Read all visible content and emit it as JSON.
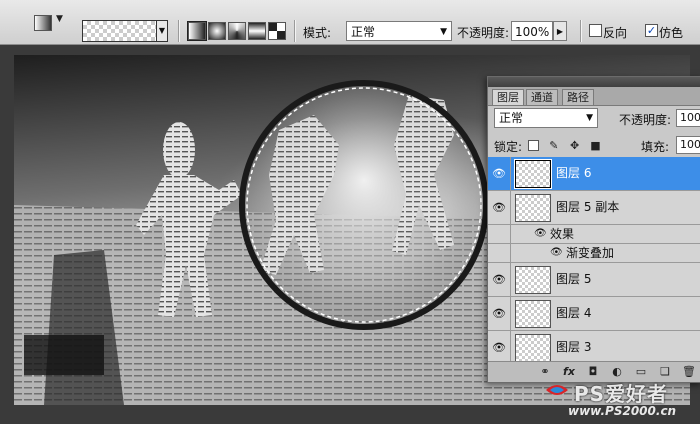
{
  "options_bar": {
    "mode_label": "模式:",
    "mode_value": "正常",
    "opacity_label": "不透明度:",
    "opacity_value": "100%",
    "reverse_label": "反向",
    "reverse_checked": false,
    "dither_label": "仿色",
    "dither_checked": true
  },
  "layers_panel": {
    "tabs": [
      {
        "label": "图层",
        "active": true
      },
      {
        "label": "通道",
        "active": false
      },
      {
        "label": "路径",
        "active": false
      }
    ],
    "blend_mode": "正常",
    "opacity_label": "不透明度:",
    "opacity_value": "100",
    "lock_label": "锁定:",
    "fill_label": "填充:",
    "fill_value": "100",
    "layers": [
      {
        "name": "图层 6",
        "selected": true
      },
      {
        "name": "图层 5 副本",
        "selected": false
      },
      {
        "name": "效果",
        "kind": "effects"
      },
      {
        "name": "渐变叠加",
        "kind": "effect"
      },
      {
        "name": "图层 5",
        "selected": false
      },
      {
        "name": "图层 4",
        "selected": false
      },
      {
        "name": "图层 3",
        "selected": false
      }
    ]
  },
  "watermark": {
    "brand": "PS爱好者",
    "url": "www.PS2000.cn"
  },
  "colors": {
    "selection": "#3d8ee8",
    "panel_bg": "#c9c9c9"
  }
}
